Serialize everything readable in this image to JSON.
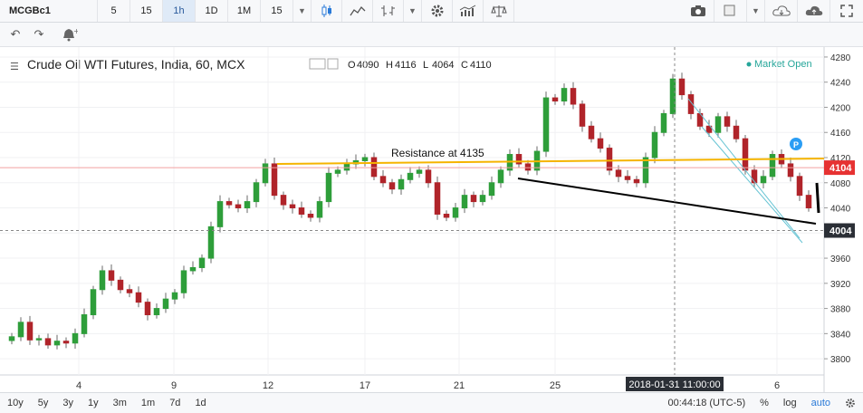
{
  "toolbar": {
    "symbol": "MCGBc1",
    "timeframes": [
      "5",
      "15",
      "1h",
      "1D",
      "1M",
      "15"
    ],
    "active_timeframe": "1h",
    "icons": [
      "candles-icon",
      "area-chart-icon",
      "bar-style-icon",
      "gear-icon",
      "indicators-icon",
      "compare-icon",
      "camera-icon",
      "square-icon",
      "cloud-download-icon",
      "cloud-upload-icon",
      "fullscreen-icon"
    ]
  },
  "header": {
    "title": "Crude Oil WTI Futures, India, 60, MCX",
    "ohlc": [
      {
        "k": "O",
        "v": "4090"
      },
      {
        "k": "H",
        "v": "4116"
      },
      {
        "k": "L",
        "v": "4064"
      },
      {
        "k": "C",
        "v": "4110"
      }
    ],
    "status": "Market Open"
  },
  "chart_data": {
    "type": "candlestick",
    "ylim": [
      3780,
      4290
    ],
    "price_axis": [
      4280,
      4240,
      4200,
      4160,
      4120,
      4080,
      4040,
      4000,
      3960,
      3920,
      3880,
      3840,
      3800
    ],
    "x_ticks": [
      "4",
      "9",
      "12",
      "17",
      "21",
      "25",
      "6"
    ],
    "crosshair": {
      "label": "2018-01-31 11:00:00",
      "price": "4004"
    },
    "current_price": "4104",
    "annotations": [
      {
        "type": "horizontal_line",
        "text": "Resistance at 4135",
        "color": "#f5b400"
      },
      {
        "type": "trend_line",
        "color": "#000000"
      },
      {
        "type": "channel",
        "color": "#67c4d4"
      }
    ],
    "series": [
      {
        "values": [
          3835,
          3858,
          3830,
          3832,
          3822,
          3828,
          3825,
          3840,
          3870,
          3910,
          3940,
          3925,
          3910,
          3905,
          3890,
          3870,
          3880,
          3895,
          3905,
          3940,
          3945,
          3960,
          4010,
          4050,
          4045,
          4040,
          4050,
          4080,
          4110,
          4060,
          4045,
          4040,
          4030,
          4025,
          4050,
          4095,
          4100,
          4110,
          4115,
          4120,
          4090,
          4080,
          4070,
          4085,
          4095,
          4100,
          4080,
          4030,
          4025,
          4040,
          4060,
          4050,
          4060,
          4080,
          4100,
          4125,
          4110,
          4100,
          4130,
          4215,
          4210,
          4230,
          4205,
          4170,
          4150,
          4135,
          4100,
          4090,
          4085,
          4080,
          4120,
          4160,
          4190,
          4245,
          4220,
          4190,
          4170,
          4160,
          4185,
          4170,
          4150,
          4100,
          4080,
          4090,
          4125,
          4110,
          4090,
          4060,
          4040
        ]
      }
    ]
  },
  "bottom": {
    "ranges": [
      "10y",
      "5y",
      "3y",
      "1y",
      "3m",
      "1m",
      "7d",
      "1d"
    ],
    "time": "00:44:18 (UTC-5)",
    "options": [
      "%",
      "log",
      "auto"
    ]
  }
}
